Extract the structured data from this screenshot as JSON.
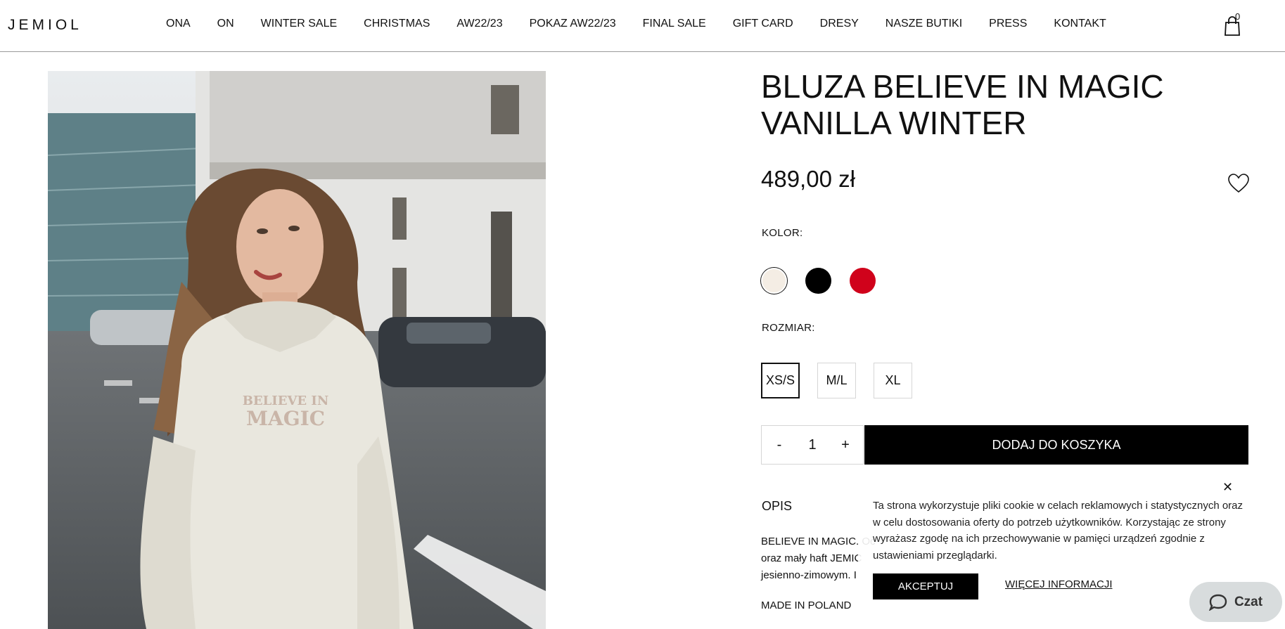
{
  "header": {
    "logo": "JEMIOL",
    "nav": [
      "ONA",
      "ON",
      "WINTER SALE",
      "CHRISTMAS",
      "AW22/23",
      "POKAZ AW22/23",
      "FINAL SALE",
      "GIFT CARD",
      "DRESY",
      "NASZE BUTIKI",
      "PRESS",
      "KONTAKT"
    ],
    "cart_count": "0",
    "cart_icon": "shopping-bag-icon"
  },
  "product": {
    "image_alt": "model-in-hoodie-photo",
    "print_text": "BELIEVE IN MAGIC",
    "title": "BLUZA BELIEVE IN MAGIC VANILLA WINTER",
    "price": "489,00 zł",
    "wishlist_icon": "heart-icon",
    "color_label": "KOLOR:",
    "colors": [
      {
        "name": "vanilla",
        "hex": "#f4ede4",
        "selected": true
      },
      {
        "name": "black",
        "hex": "#000000",
        "selected": false
      },
      {
        "name": "red",
        "hex": "#d0021b",
        "selected": false
      }
    ],
    "size_label": "ROZMIAR:",
    "sizes": [
      {
        "label": "XS/S",
        "selected": true
      },
      {
        "label": "M/L",
        "selected": false
      },
      {
        "label": "XL",
        "selected": false
      }
    ],
    "qty_minus": "-",
    "qty_value": "1",
    "qty_plus": "+",
    "add_to_cart": "DODAJ DO KOSZYKA",
    "description_title": "OPIS",
    "description_visible": "BELIEVE IN MAGIC. Oc",
    "description_line2": "oraz mały haft JEMIC",
    "description_line3": "jesienno-zimowym. I",
    "made_in": "MADE IN POLAND"
  },
  "cookie": {
    "text": "Ta strona wykorzystuje pliki cookie w celach reklamowych i statystycznych oraz w celu dostosowania oferty do potrzeb użytkowników. Korzystając ze strony wyrażasz zgodę na ich przechowywanie w pamięci urządzeń zgodnie z ustawieniami przeglądarki.",
    "accept": "AKCEPTUJ",
    "more": "WIĘCEJ INFORMACJI",
    "close_icon": "close-icon"
  },
  "chat": {
    "label": "Czat",
    "icon": "chat-bubble-icon"
  }
}
